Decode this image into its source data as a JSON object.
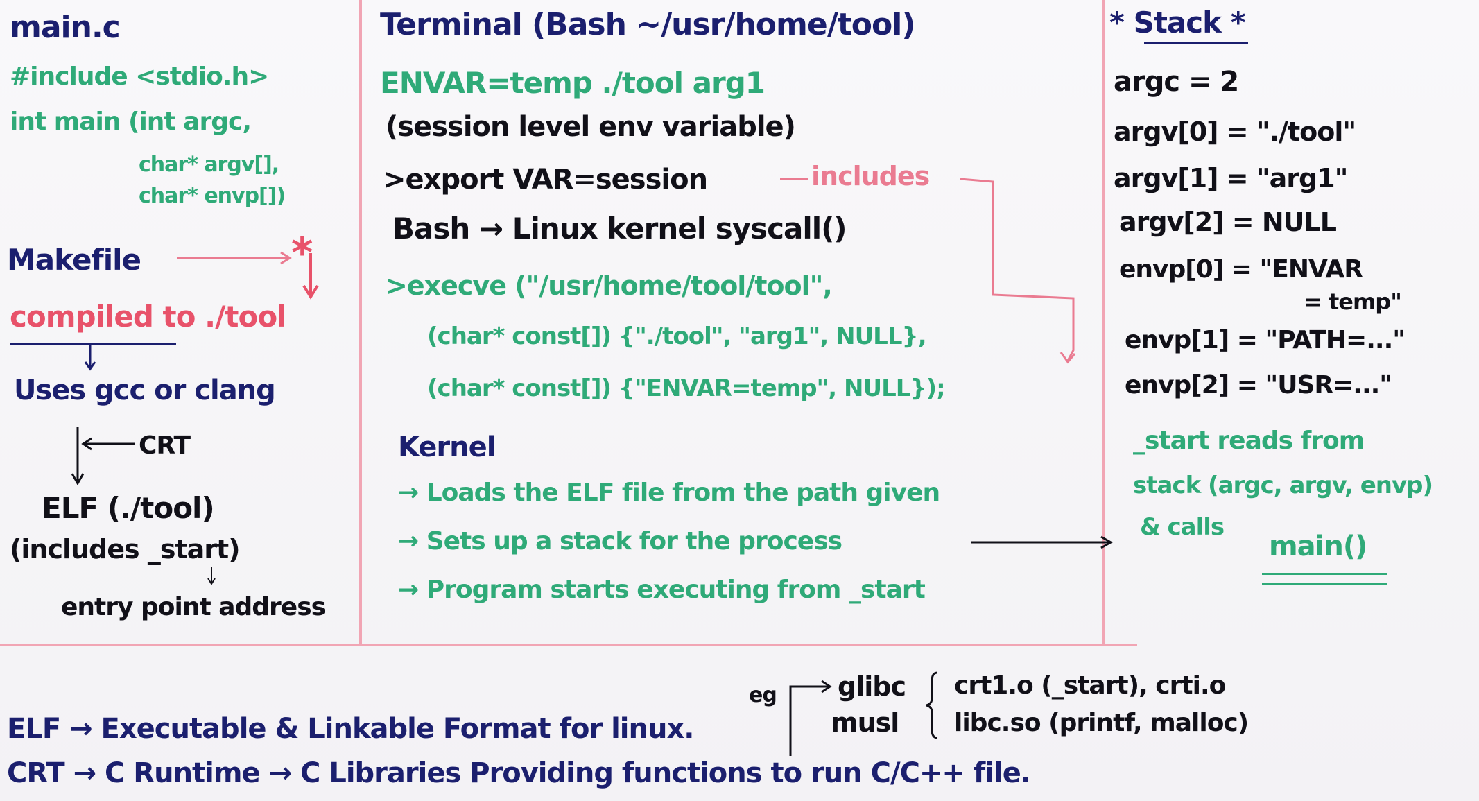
{
  "left_panel": {
    "title": "main.c",
    "code": [
      "#include <stdio.h>",
      "int main (int argc,",
      "char* argv[],",
      "char* envp[])"
    ],
    "makefile_label": "Makefile",
    "compiled_to": "compiled to ./tool",
    "uses": "Uses gcc or clang",
    "crt": "CRT",
    "elf": "ELF (./tool)",
    "includes_start": "(includes _start)",
    "entry_point": "entry point address",
    "star": "*"
  },
  "middle_panel": {
    "title": "Terminal (Bash ~/usr/home/tool)",
    "command": "ENVAR=temp ./tool arg1",
    "session_note": "(session level env variable)",
    "export_line": ">export VAR=session",
    "includes_label": "includes",
    "bash_line": "Bash → Linux kernel syscall()",
    "execve_lines": [
      ">execve (\"/usr/home/tool/tool\",",
      "(char* const[]) {\"./tool\", \"arg1\", NULL},",
      "(char* const[]) {\"ENVAR=temp\", NULL});"
    ],
    "kernel_title": "Kernel",
    "kernel_steps": [
      "→ Loads the ELF file from the path given",
      "→ Sets up a stack for the process",
      "→ Program starts executing from _start"
    ]
  },
  "right_panel": {
    "title": "* Stack *",
    "entries": [
      "argc = 2",
      "argv[0] = \"./tool\"",
      "argv[1] = \"arg1\"",
      "argv[2] = NULL",
      "envp[0] = \"ENVAR",
      "= temp\"",
      "envp[1] = \"PATH=...\"",
      "envp[2] = \"USR=...\""
    ],
    "start_note": [
      "_start reads from",
      "stack (argc, argv, envp)",
      "& calls"
    ],
    "main_call": "main()"
  },
  "bottom": {
    "elf_def": "ELF → Executable & Linkable Format for linux.",
    "crt_def": "CRT → C Runtime → C Libraries Providing functions to run C/C++ file.",
    "eg": "eg",
    "libs": [
      "glibc",
      "musl"
    ],
    "files": [
      "crt1.o (_start), crti.o",
      "libc.so (printf, malloc)"
    ]
  },
  "colors": {
    "navy": "#1b1f6e",
    "black": "#111018",
    "green": "#2faa78",
    "red": "#e8526a",
    "pink": "#ea7b91",
    "divider": "#f1a5b4"
  }
}
